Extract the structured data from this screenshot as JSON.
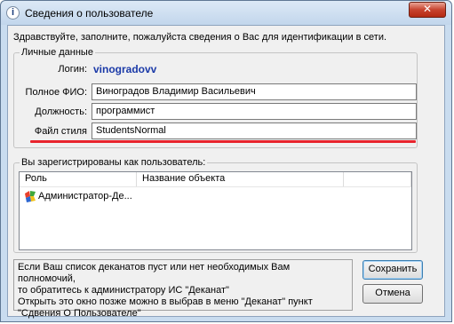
{
  "window": {
    "title": "Сведения о пользователе",
    "close_glyph": "✕"
  },
  "greeting": "Здравствуйте, заполните, пожалуйста сведения о Вас для идентификации в сети.",
  "personal": {
    "legend": "Личные данные",
    "login_label": "Логин:",
    "login_value": "vinogradovv",
    "fullname_label": "Полное ФИО:",
    "fullname_value": "Виноградов Владимир Васильевич",
    "position_label": "Должность:",
    "position_value": "программист",
    "style_label": "Файл стиля",
    "style_value": "StudentsNormal",
    "highlight_color": "#e8242d"
  },
  "roles": {
    "legend": "Вы зарегистрированы как пользователь:",
    "columns": [
      "Роль",
      "Название объекта"
    ],
    "rows": [
      {
        "role": "Администратор-Де...",
        "object": "",
        "icon": "admin-role-icon"
      }
    ]
  },
  "info_text": [
    "Если Ваш список деканатов пуст или нет необходимых Вам полномочий,",
    "то обратитесь к администратору ИС \"Деканат\"",
    "Открыть это окно позже можно в выбрав в меню \"Деканат\" пункт",
    "\"Сдвения О Пользователе\""
  ],
  "buttons": {
    "save": "Сохранить",
    "cancel": "Отмена"
  }
}
